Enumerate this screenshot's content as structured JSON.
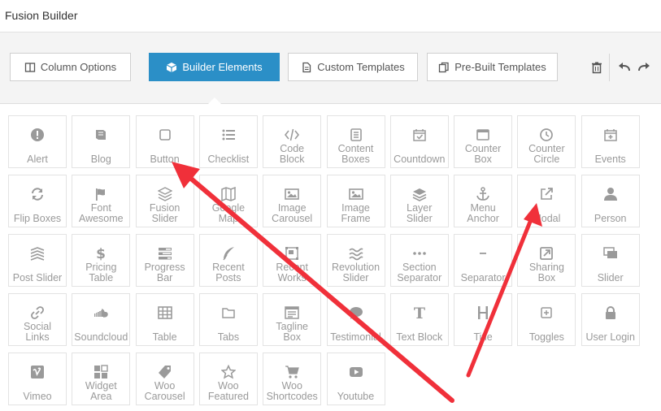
{
  "window": {
    "title": "Fusion Builder"
  },
  "tabs": [
    {
      "label": "Column Options",
      "icon": "columns-icon",
      "active": false
    },
    {
      "label": "Builder Elements",
      "icon": "cube-icon",
      "active": true
    },
    {
      "label": "Custom Templates",
      "icon": "file-icon",
      "active": false
    },
    {
      "label": "Pre-Built Templates",
      "icon": "copy-icon",
      "active": false
    }
  ],
  "toolbar_icons": [
    "trash-icon",
    "undo-icon",
    "redo-icon"
  ],
  "colors": {
    "accent": "#2b8fc7",
    "arrow": "#f0303a",
    "element_text": "#9a9a9a"
  },
  "elements": [
    {
      "label": "Alert",
      "icon": "alert-icon"
    },
    {
      "label": "Blog",
      "icon": "book-icon"
    },
    {
      "label": "Button",
      "icon": "square-icon"
    },
    {
      "label": "Checklist",
      "icon": "list-icon"
    },
    {
      "label": "Code\nBlock",
      "icon": "code-icon"
    },
    {
      "label": "Content\nBoxes",
      "icon": "content-boxes-icon"
    },
    {
      "label": "Countdown",
      "icon": "calendar-check-icon"
    },
    {
      "label": "Counter\nBox",
      "icon": "window-icon"
    },
    {
      "label": "Counter\nCircle",
      "icon": "clock-icon"
    },
    {
      "label": "Events",
      "icon": "calendar-plus-icon"
    },
    {
      "label": "Flip Boxes",
      "icon": "refresh-icon"
    },
    {
      "label": "Font\nAwesome",
      "icon": "flag-icon"
    },
    {
      "label": "Fusion\nSlider",
      "icon": "fusion-icon"
    },
    {
      "label": "Google\nMap",
      "icon": "map-icon"
    },
    {
      "label": "Image\nCarousel",
      "icon": "image-icon"
    },
    {
      "label": "Image\nFrame",
      "icon": "image-frame-icon"
    },
    {
      "label": "Layer\nSlider",
      "icon": "layers-icon"
    },
    {
      "label": "Menu\nAnchor",
      "icon": "anchor-icon"
    },
    {
      "label": "Modal",
      "icon": "external-link-icon"
    },
    {
      "label": "Person",
      "icon": "person-icon"
    },
    {
      "label": "Post Slider",
      "icon": "post-slider-icon"
    },
    {
      "label": "Pricing\nTable",
      "icon": "dollar-icon"
    },
    {
      "label": "Progress\nBar",
      "icon": "tasks-icon"
    },
    {
      "label": "Recent\nPosts",
      "icon": "feather-icon"
    },
    {
      "label": "Recent\nWorks",
      "icon": "object-group-icon"
    },
    {
      "label": "Revolution\nSlider",
      "icon": "waves-icon"
    },
    {
      "label": "Section\nSeparator",
      "icon": "ellipsis-icon"
    },
    {
      "label": "Separator",
      "icon": "minus-icon"
    },
    {
      "label": "Sharing\nBox",
      "icon": "share-square-icon"
    },
    {
      "label": "Slider",
      "icon": "slides-icon"
    },
    {
      "label": "Social\nLinks",
      "icon": "link-icon"
    },
    {
      "label": "Soundcloud",
      "icon": "soundcloud-icon"
    },
    {
      "label": "Table",
      "icon": "table-icon"
    },
    {
      "label": "Tabs",
      "icon": "folder-icon"
    },
    {
      "label": "Tagline\nBox",
      "icon": "tagline-icon"
    },
    {
      "label": "Testimonial",
      "icon": "comment-icon"
    },
    {
      "label": "Text Block",
      "icon": "text-icon"
    },
    {
      "label": "Title",
      "icon": "heading-icon"
    },
    {
      "label": "Toggles",
      "icon": "plus-square-icon"
    },
    {
      "label": "User Login",
      "icon": "lock-icon"
    },
    {
      "label": "Vimeo",
      "icon": "vimeo-icon"
    },
    {
      "label": "Widget\nArea",
      "icon": "widget-icon"
    },
    {
      "label": "Woo\nCarousel",
      "icon": "tag-icon"
    },
    {
      "label": "Woo\nFeatured",
      "icon": "star-icon"
    },
    {
      "label": "Woo\nShortcodes",
      "icon": "cart-icon"
    },
    {
      "label": "Youtube",
      "icon": "youtube-icon"
    }
  ]
}
